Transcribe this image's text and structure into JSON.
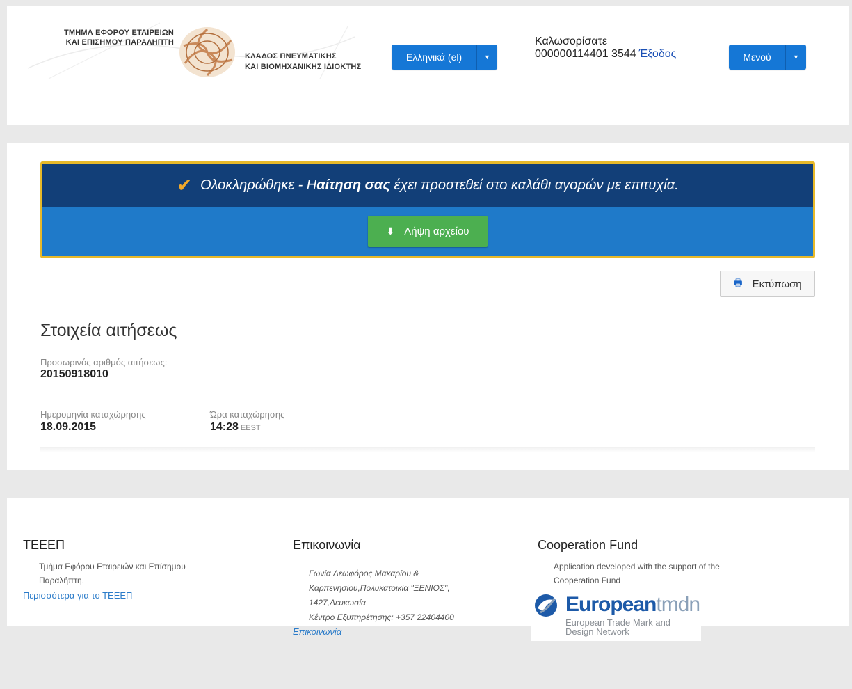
{
  "header": {
    "logo_left_line1": "ΤΜΗΜΑ ΕΦΟΡΟΥ ΕΤΑΙΡΕΙΩΝ",
    "logo_left_line2": "ΚΑΙ ΕΠΙΣΗΜΟΥ ΠΑΡΑΛΗΠΤΗ",
    "logo_right_line1": "ΚΛΑΔΟΣ ΠΝΕΥΜΑΤΙΚΗΣ",
    "logo_right_line2": "ΚΑΙ ΒΙΟΜΗΧΑΝΙΚΗΣ ΙΔΙΟΚΤΗΣ",
    "language_label": "Ελληνικά (el)",
    "welcome_label": "Καλωσορίσατε",
    "user_id": "000000114401 3544",
    "logout_label": "Έξοδος",
    "menu_label": "Μενού"
  },
  "alert": {
    "message_prefix": "Ολοκληρώθηκε - Η ",
    "message_bold": "αίτηση σας",
    "message_suffix": " έχει προστεθεί στο καλάθι αγορών με επιτυχία.",
    "download_label": "Λήψη αρχείου"
  },
  "print_label": "Εκτύπωση",
  "details": {
    "title": "Στοιχεία αιτήσεως",
    "temp_number_label": "Προσωρινός αριθμός αιτήσεως:",
    "temp_number_value": "20150918010",
    "date_label": "Ημερομηνία καταχώρησης",
    "date_value": "18.09.2015",
    "time_label": "Ώρα καταχώρησης",
    "time_value": "14:28",
    "time_zone": "EEST"
  },
  "footer": {
    "col1_title": "ΤΕΕΕΠ",
    "col1_text_line1": "Τμήμα Εφόρου Εταιρειών και Επίσημου",
    "col1_text_line2": "Παραλήπτη.",
    "col1_link": "Περισσότερα για το ΤΕΕΕΠ",
    "col2_title": "Επικοινωνία",
    "col2_addr_line1": "Γωνία Λεωφόρος Μακαρίου &",
    "col2_addr_line2": "Καρπενησίου,Πολυκατοικία \"ΞΕΝΙΟΣ\",",
    "col2_addr_line3": "1427,Λευκωσία",
    "col2_addr_line4": "Κέντρο Εξυπηρέτησης: +357 22404400",
    "col2_link": "Επικοινωνία",
    "col3_title": "Cooperation Fund",
    "col3_text_line1": "Application developed with the support of the",
    "col3_text_line2": "Cooperation Fund",
    "tmdn_word_bold": "European",
    "tmdn_word_light": "tmdn",
    "tmdn_sub_line1": "European Trade Mark and",
    "tmdn_sub_line2": "Design Network"
  },
  "colors": {
    "primary_blue": "#1577d6",
    "alert_dark": "#123f78",
    "alert_border": "#e7b92a",
    "success_green": "#4caf50",
    "link_blue": "#2a7bc9"
  }
}
